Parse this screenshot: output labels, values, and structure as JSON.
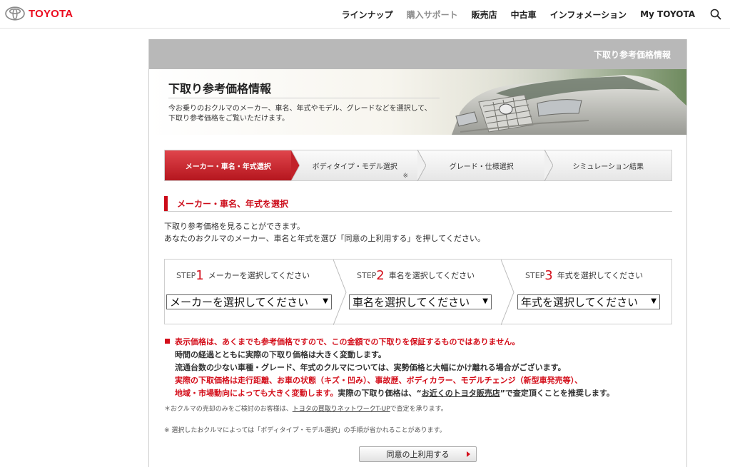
{
  "header": {
    "brand": "TOYOTA",
    "nav": [
      "ラインナップ",
      "購入サポート",
      "販売店",
      "中古車",
      "インフォメーション",
      "My TOYOTA"
    ],
    "active_index": 1
  },
  "frame": {
    "bar_title": "下取り参考価格情報"
  },
  "hero": {
    "title": "下取り参考価格情報",
    "desc_line1": "今お乗りのおクルマのメーカー、車名、年式やモデル、グレードなどを選択して、",
    "desc_line2": "下取り参考価格をご覧いただけます。"
  },
  "process": {
    "steps": [
      "メーカー・車名・年式選択",
      "ボディタイプ・モデル選択",
      "グレード・仕様選択",
      "シミュレーション結果"
    ],
    "step2_note": "※",
    "active_index": 0
  },
  "section": {
    "title": "メーカー・車名、年式を選択",
    "intro1": "下取り参考価格を見ることができます。",
    "intro2": "あなたのおクルマのメーカー、車名と年式を選び「同意の上利用する」を押してください。"
  },
  "selectors": [
    {
      "step_word": "STEP",
      "num": "1",
      "label": "メーカーを選択してください",
      "value": "メーカーを選択してください"
    },
    {
      "step_word": "STEP",
      "num": "2",
      "label": "車名を選択してください",
      "value": "車名を選択してください"
    },
    {
      "step_word": "STEP",
      "num": "3",
      "label": "年式を選択してください",
      "value": "年式を選択してください"
    }
  ],
  "notices": {
    "line1": "表示価格は、あくまでも参考価格ですので、この金額での下取りを保証するものではありません。",
    "line2": "時間の経過とともに実際の下取り価格は大きく変動します。",
    "line3": "流通台数の少ない車種・グレード、年式のクルマについては、実勢価格と大幅にかけ離れる場合がございます。",
    "line4": "実際の下取価格は走行距離、お車の状態（キズ・凹み）、事故歴、ボディカラー、モデルチェンジ（新型車発売等）、",
    "line5a": "地域・市場動向によっても大きく変動します。",
    "line5b": "実際の下取り価格は、“",
    "line5_link": "お近くのトヨタ販売店",
    "line5c": "”で査定頂くことを推奨します。",
    "note1a": "＊おクルマの売却のみをご検討のお客様は、",
    "note1_link": "トヨタの買取りネットワークT-UP",
    "note1b": "で査定を承ります。",
    "note2": "※ 選択したおクルマによっては「ボディタイプ・モデル選択」の手順が省かれることがあります。"
  },
  "agree_button": "同意の上利用する",
  "colors": {
    "brand_red": "#eb0a1e",
    "accent_red": "#d40f1b",
    "bar_gray": "#b8b8b8"
  }
}
